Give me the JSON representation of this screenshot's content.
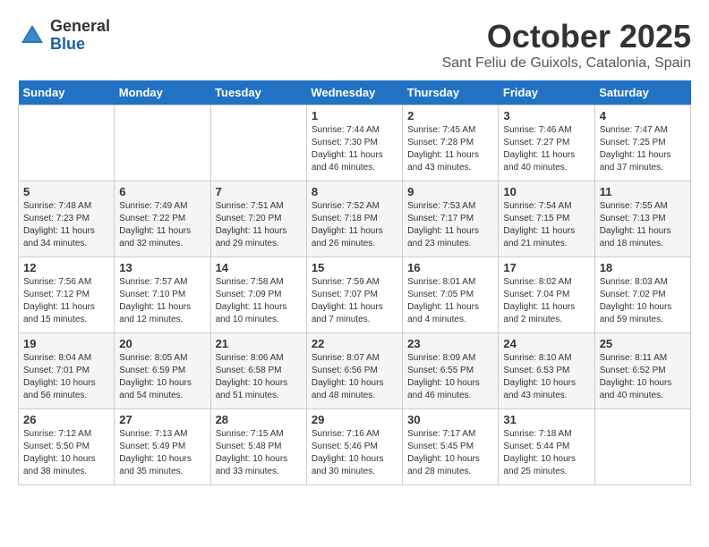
{
  "header": {
    "logo_general": "General",
    "logo_blue": "Blue",
    "month": "October 2025",
    "location": "Sant Feliu de Guixols, Catalonia, Spain"
  },
  "weekdays": [
    "Sunday",
    "Monday",
    "Tuesday",
    "Wednesday",
    "Thursday",
    "Friday",
    "Saturday"
  ],
  "weeks": [
    [
      {
        "day": "",
        "info": ""
      },
      {
        "day": "",
        "info": ""
      },
      {
        "day": "",
        "info": ""
      },
      {
        "day": "1",
        "info": "Sunrise: 7:44 AM\nSunset: 7:30 PM\nDaylight: 11 hours\nand 46 minutes."
      },
      {
        "day": "2",
        "info": "Sunrise: 7:45 AM\nSunset: 7:28 PM\nDaylight: 11 hours\nand 43 minutes."
      },
      {
        "day": "3",
        "info": "Sunrise: 7:46 AM\nSunset: 7:27 PM\nDaylight: 11 hours\nand 40 minutes."
      },
      {
        "day": "4",
        "info": "Sunrise: 7:47 AM\nSunset: 7:25 PM\nDaylight: 11 hours\nand 37 minutes."
      }
    ],
    [
      {
        "day": "5",
        "info": "Sunrise: 7:48 AM\nSunset: 7:23 PM\nDaylight: 11 hours\nand 34 minutes."
      },
      {
        "day": "6",
        "info": "Sunrise: 7:49 AM\nSunset: 7:22 PM\nDaylight: 11 hours\nand 32 minutes."
      },
      {
        "day": "7",
        "info": "Sunrise: 7:51 AM\nSunset: 7:20 PM\nDaylight: 11 hours\nand 29 minutes."
      },
      {
        "day": "8",
        "info": "Sunrise: 7:52 AM\nSunset: 7:18 PM\nDaylight: 11 hours\nand 26 minutes."
      },
      {
        "day": "9",
        "info": "Sunrise: 7:53 AM\nSunset: 7:17 PM\nDaylight: 11 hours\nand 23 minutes."
      },
      {
        "day": "10",
        "info": "Sunrise: 7:54 AM\nSunset: 7:15 PM\nDaylight: 11 hours\nand 21 minutes."
      },
      {
        "day": "11",
        "info": "Sunrise: 7:55 AM\nSunset: 7:13 PM\nDaylight: 11 hours\nand 18 minutes."
      }
    ],
    [
      {
        "day": "12",
        "info": "Sunrise: 7:56 AM\nSunset: 7:12 PM\nDaylight: 11 hours\nand 15 minutes."
      },
      {
        "day": "13",
        "info": "Sunrise: 7:57 AM\nSunset: 7:10 PM\nDaylight: 11 hours\nand 12 minutes."
      },
      {
        "day": "14",
        "info": "Sunrise: 7:58 AM\nSunset: 7:09 PM\nDaylight: 11 hours\nand 10 minutes."
      },
      {
        "day": "15",
        "info": "Sunrise: 7:59 AM\nSunset: 7:07 PM\nDaylight: 11 hours\nand 7 minutes."
      },
      {
        "day": "16",
        "info": "Sunrise: 8:01 AM\nSunset: 7:05 PM\nDaylight: 11 hours\nand 4 minutes."
      },
      {
        "day": "17",
        "info": "Sunrise: 8:02 AM\nSunset: 7:04 PM\nDaylight: 11 hours\nand 2 minutes."
      },
      {
        "day": "18",
        "info": "Sunrise: 8:03 AM\nSunset: 7:02 PM\nDaylight: 10 hours\nand 59 minutes."
      }
    ],
    [
      {
        "day": "19",
        "info": "Sunrise: 8:04 AM\nSunset: 7:01 PM\nDaylight: 10 hours\nand 56 minutes."
      },
      {
        "day": "20",
        "info": "Sunrise: 8:05 AM\nSunset: 6:59 PM\nDaylight: 10 hours\nand 54 minutes."
      },
      {
        "day": "21",
        "info": "Sunrise: 8:06 AM\nSunset: 6:58 PM\nDaylight: 10 hours\nand 51 minutes."
      },
      {
        "day": "22",
        "info": "Sunrise: 8:07 AM\nSunset: 6:56 PM\nDaylight: 10 hours\nand 48 minutes."
      },
      {
        "day": "23",
        "info": "Sunrise: 8:09 AM\nSunset: 6:55 PM\nDaylight: 10 hours\nand 46 minutes."
      },
      {
        "day": "24",
        "info": "Sunrise: 8:10 AM\nSunset: 6:53 PM\nDaylight: 10 hours\nand 43 minutes."
      },
      {
        "day": "25",
        "info": "Sunrise: 8:11 AM\nSunset: 6:52 PM\nDaylight: 10 hours\nand 40 minutes."
      }
    ],
    [
      {
        "day": "26",
        "info": "Sunrise: 7:12 AM\nSunset: 5:50 PM\nDaylight: 10 hours\nand 38 minutes."
      },
      {
        "day": "27",
        "info": "Sunrise: 7:13 AM\nSunset: 5:49 PM\nDaylight: 10 hours\nand 35 minutes."
      },
      {
        "day": "28",
        "info": "Sunrise: 7:15 AM\nSunset: 5:48 PM\nDaylight: 10 hours\nand 33 minutes."
      },
      {
        "day": "29",
        "info": "Sunrise: 7:16 AM\nSunset: 5:46 PM\nDaylight: 10 hours\nand 30 minutes."
      },
      {
        "day": "30",
        "info": "Sunrise: 7:17 AM\nSunset: 5:45 PM\nDaylight: 10 hours\nand 28 minutes."
      },
      {
        "day": "31",
        "info": "Sunrise: 7:18 AM\nSunset: 5:44 PM\nDaylight: 10 hours\nand 25 minutes."
      },
      {
        "day": "",
        "info": ""
      }
    ]
  ]
}
